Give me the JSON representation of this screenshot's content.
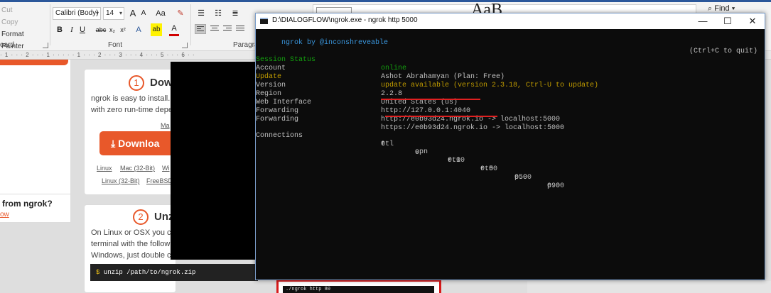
{
  "ribbon": {
    "clipboard": {
      "cut": "Cut",
      "copy": "Copy",
      "format_painter": "Format Painter",
      "group_label": "oard"
    },
    "font": {
      "family": "Calibri (Body)",
      "size": "14",
      "grow": "A",
      "shrink": "A",
      "case": "Aa",
      "bold": "B",
      "italic": "I",
      "underline": "U",
      "strike": "abc",
      "subscript": "x₂",
      "superscript": "x²",
      "text_effects": "A",
      "highlight": "ab",
      "font_color": "A",
      "group_label": "Font"
    },
    "paragraph": {
      "group_label": "Paragra"
    },
    "styles_preview": "AaB",
    "find_label": "Find"
  },
  "ruler_marks": "· 1 · · · 2 · · · 1 · · · · · 1 · · · 2 · · · 3 · · · 4 · · · 5 · · · 6 · ·",
  "page": {
    "sidebar_question": "from ngrok?",
    "sidebar_link": "ow",
    "step1": {
      "number": "1",
      "title": "Dow",
      "text_line1": "ngrok is easy to install. D",
      "text_line2": "with zero run-time depe",
      "mac_link": "Ma",
      "download_label": "Downloa",
      "links_row1": [
        "Linux",
        "Mac (32-Bit)",
        "Wi"
      ],
      "links_row2": [
        "Linux (32-Bit)",
        "FreeBSD"
      ]
    },
    "step2": {
      "number": "2",
      "title": "Unzi",
      "text_line1": "On Linux or OSX you can",
      "text_line2": "terminal with the follow",
      "text_line3": "Windows, just double cli",
      "code_prompt": "$",
      "code_text": "unzip /path/to/ngrok.zip"
    },
    "bottom_code": "./ngrok http 80"
  },
  "console": {
    "title": "D:\\DIALOGFLOW\\ngrok.exe - ngrok  http 5000",
    "minimize": "—",
    "maximize": "☐",
    "close": "✕",
    "banner_left": "ngrok by ",
    "banner_handle": "@inconshreveable",
    "banner_right": "(Ctrl+C to quit)",
    "session_status_label": "Session Status",
    "session_status_value": "online",
    "account_label": "Account",
    "account_value": "Ashot Abrahamyan (Plan: Free)",
    "update_label": "Update",
    "update_value": "update available (version 2.3.18, Ctrl-U to update)",
    "version_label": "Version",
    "version_value": "2.2.8",
    "region_label": "Region",
    "region_value": "United States (us)",
    "web_interface_label": "Web Interface",
    "web_interface_value": "http://127.0.0.1:4040",
    "forwarding1_label": "Forwarding",
    "forwarding1_value": "http://e0b93d24.ngrok.io -> localhost:5000",
    "forwarding2_label": "Forwarding",
    "forwarding2_value": "https://e0b93d24.ngrok.io -> localhost:5000",
    "connections_label": "Connections",
    "conn_headers": [
      "ttl",
      "opn",
      "rt1",
      "rt5",
      "p50",
      "p90"
    ],
    "conn_values": [
      "0",
      "0",
      "0.00",
      "0.00",
      "0.00",
      "0.00"
    ]
  },
  "colors": {
    "ngrok_orange": "#e8582a",
    "console_bg": "#0c0c0c",
    "console_green": "#13a10e",
    "console_yellow": "#c19c00",
    "console_cyan": "#3a96dd",
    "annotation_red": "#e02020"
  }
}
